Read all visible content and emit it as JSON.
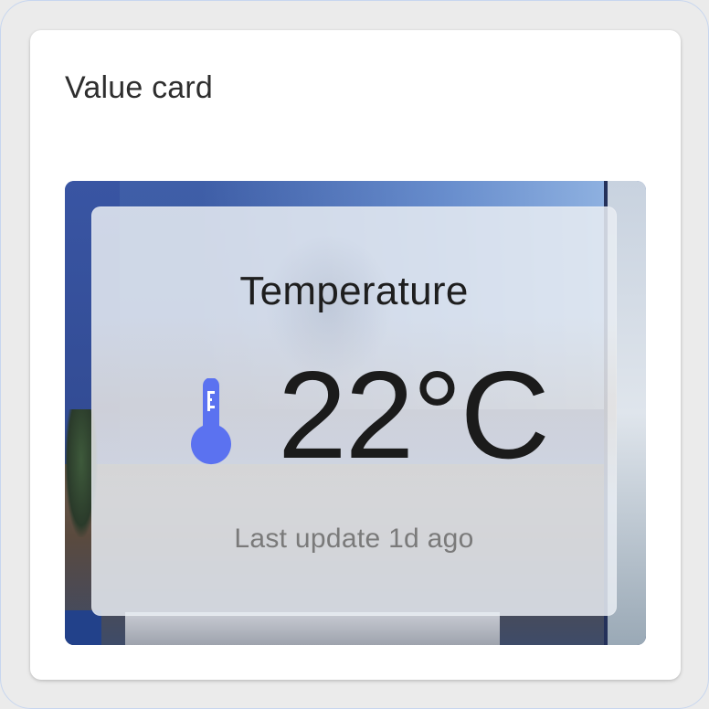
{
  "card": {
    "title": "Value card"
  },
  "widget": {
    "label": "Temperature",
    "value": "22°C",
    "status": "Last update 1d ago",
    "icon": "thermometer-icon",
    "icon_color": "#5b72f0"
  }
}
